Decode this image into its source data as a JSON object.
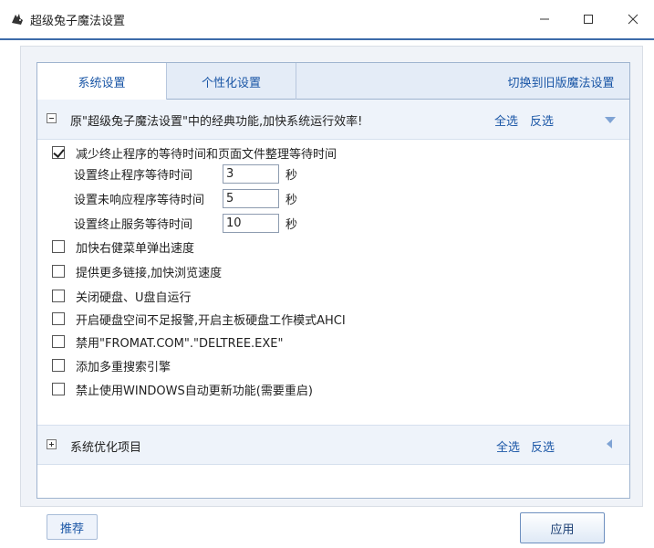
{
  "window": {
    "title": "超级兔子魔法设置",
    "minimize_glyph": "—",
    "maximize_glyph": "☐",
    "close_glyph": "✕"
  },
  "tabs": [
    {
      "label": "系统设置",
      "active": true
    },
    {
      "label": "个性化设置",
      "active": false
    },
    {
      "label": "切换到旧版魔法设置",
      "active": false
    }
  ],
  "groups": [
    {
      "title": "原\"超级兔子魔法设置\"中的经典功能,加快系统运行效率!",
      "select_all": "全选",
      "invert": "反选",
      "expanded": true
    },
    {
      "title": "系统优化项目",
      "select_all": "全选",
      "invert": "反选",
      "expanded": false
    }
  ],
  "options": [
    {
      "label": "减少终止程序的等待时间和页面文件整理等待时间",
      "checked": true
    },
    {
      "label": "加快右健菜单弹出速度",
      "checked": false
    },
    {
      "label": "提供更多链接,加快浏览速度",
      "checked": false
    },
    {
      "label": "关闭硬盘、U盘自运行",
      "checked": false
    },
    {
      "label": "开启硬盘空间不足报警,开启主板硬盘工作模式AHCI",
      "checked": false
    },
    {
      "label": "禁用\"FROMAT.COM\".\"DELTREE.EXE\"",
      "checked": false
    },
    {
      "label": "添加多重搜索引擎",
      "checked": false
    },
    {
      "label": "禁止使用WINDOWS自动更新功能(需要重启)",
      "checked": false
    }
  ],
  "timeouts": [
    {
      "label": "设置终止程序等待时间",
      "value": "3",
      "unit": "秒"
    },
    {
      "label": "设置未响应程序等待时间",
      "value": "5",
      "unit": "秒"
    },
    {
      "label": "设置终止服务等待时间",
      "value": "10",
      "unit": "秒"
    }
  ],
  "buttons": {
    "recommend": "推荐",
    "apply": "应用"
  },
  "colors": {
    "accent": "#1a56a6",
    "tab_bg": "#e4ecf7",
    "border": "#9fb4cf",
    "title_separator": "#3c6ba9"
  }
}
